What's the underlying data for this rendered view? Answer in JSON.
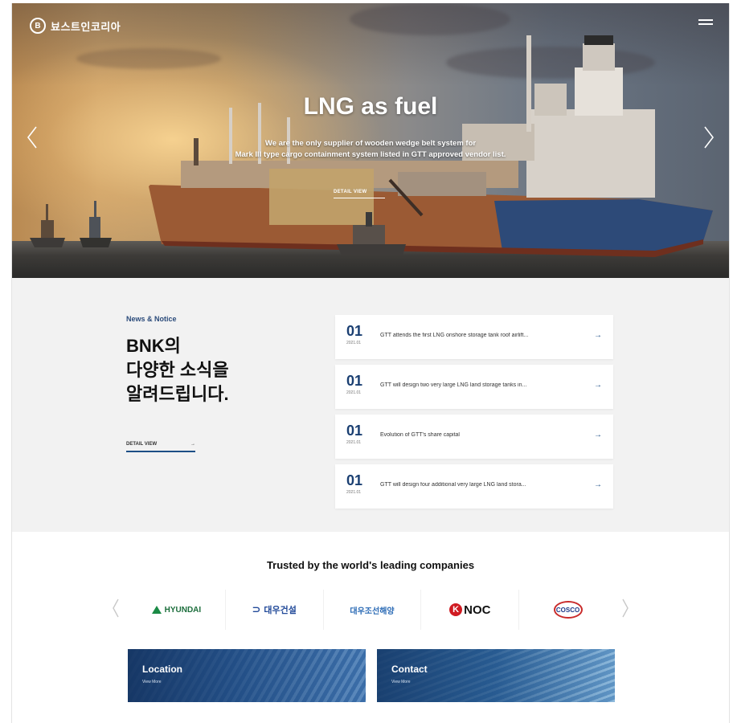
{
  "header": {
    "logo_text": "뵤스트인코리아",
    "logo_mark": "B"
  },
  "hero": {
    "title": "LNG as fuel",
    "subtitle_line1": "We are the only supplier of wooden wedge belt system for",
    "subtitle_line2": "Mark III type cargo containment system listed in GTT approved vendor list.",
    "detail_label": "DETAIL VIEW"
  },
  "news": {
    "kicker": "News & Notice",
    "headline_line1": "BNK의",
    "headline_line2": "다양한 소식을",
    "headline_line3": "알려드립니다.",
    "detail_label": "DETAIL VIEW",
    "detail_arrow": "→",
    "items": [
      {
        "num": "01",
        "date": "2021.01",
        "text": "GTT attends the first LNG onshore storage tank roof airlift...",
        "arrow": "→"
      },
      {
        "num": "01",
        "date": "2021.01",
        "text": "GTT will design two very large LNG land storage tanks in...",
        "arrow": "→"
      },
      {
        "num": "01",
        "date": "2021.01",
        "text": "Evolution of GTT's share capital",
        "arrow": "→"
      },
      {
        "num": "01",
        "date": "2021.01",
        "text": "GTT will design four additional very large LNG land stora...",
        "arrow": "→"
      }
    ]
  },
  "trusted": {
    "title": "Trusted by the world's leading companies",
    "logos": [
      {
        "name": "HYUNDAI"
      },
      {
        "name": "대우건설"
      },
      {
        "name": "대우조선해양"
      },
      {
        "name": "NOC",
        "mark": "K"
      },
      {
        "name": "COSCO"
      }
    ]
  },
  "cards": [
    {
      "title": "Location",
      "more": "View More"
    },
    {
      "title": "Contact",
      "more": "View More"
    }
  ],
  "colors": {
    "accent_navy": "#1a3f72",
    "news_bg": "#f2f2f2",
    "card_blue": "#1f4d86"
  }
}
